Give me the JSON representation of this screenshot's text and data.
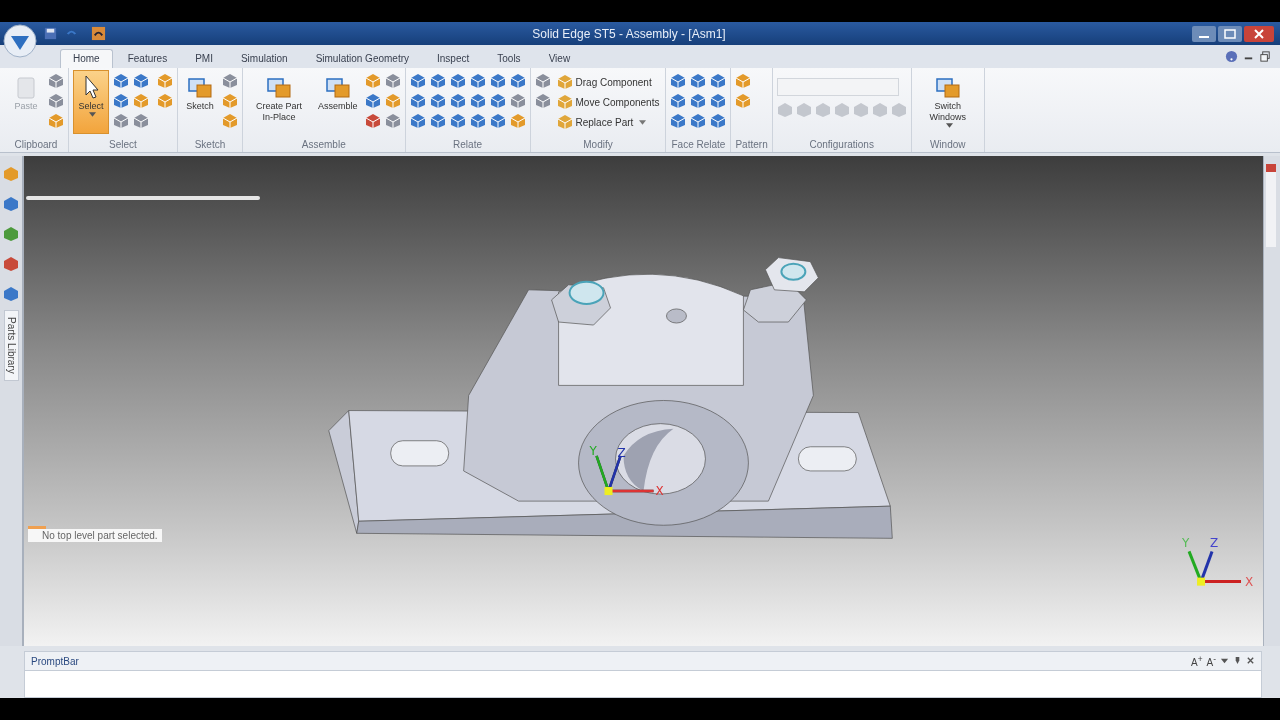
{
  "window": {
    "title": "Solid Edge ST5 - Assembly - [Asm1]"
  },
  "tabs": [
    {
      "label": "Home",
      "selected": true
    },
    {
      "label": "Features",
      "selected": false
    },
    {
      "label": "PMI",
      "selected": false
    },
    {
      "label": "Simulation",
      "selected": false
    },
    {
      "label": "Simulation Geometry",
      "selected": false
    },
    {
      "label": "Inspect",
      "selected": false
    },
    {
      "label": "Tools",
      "selected": false
    },
    {
      "label": "View",
      "selected": false
    }
  ],
  "ribbon_groups": [
    {
      "label": "Clipboard",
      "large": [
        {
          "label": "Paste",
          "disabled": true,
          "selected": false,
          "dropdown": false
        }
      ]
    },
    {
      "label": "Select",
      "large": [
        {
          "label": "Select",
          "disabled": false,
          "selected": true,
          "dropdown": true
        }
      ]
    },
    {
      "label": "Sketch",
      "large": [
        {
          "label": "Sketch",
          "disabled": false,
          "selected": false,
          "dropdown": false
        }
      ]
    },
    {
      "label": "Assemble",
      "large": [
        {
          "label": "Create Part In-Place",
          "disabled": false,
          "selected": false,
          "dropdown": false
        },
        {
          "label": "Assemble",
          "disabled": false,
          "selected": false,
          "dropdown": false
        }
      ]
    },
    {
      "label": "Relate"
    },
    {
      "label": "Modify",
      "commands": [
        {
          "label": "Drag Component",
          "dropdown": false
        },
        {
          "label": "Move Components",
          "dropdown": false
        },
        {
          "label": "Replace Part",
          "dropdown": true
        }
      ]
    },
    {
      "label": "Face Relate"
    },
    {
      "label": "Pattern"
    },
    {
      "label": "Configurations"
    },
    {
      "label": "Window",
      "large": [
        {
          "label": "Switch Windows",
          "disabled": false,
          "selected": false,
          "dropdown": true
        }
      ]
    }
  ],
  "sidebar": {
    "tab_label": "Parts Library"
  },
  "viewport": {
    "status": "No top level part selected.",
    "model_triad": [
      "X",
      "Y",
      "Z"
    ],
    "view_triad": [
      "X",
      "Y",
      "Z"
    ]
  },
  "prompt_bar": {
    "title": "PromptBar",
    "tools": [
      "A$^{+}$",
      "A$^{-}$"
    ]
  }
}
